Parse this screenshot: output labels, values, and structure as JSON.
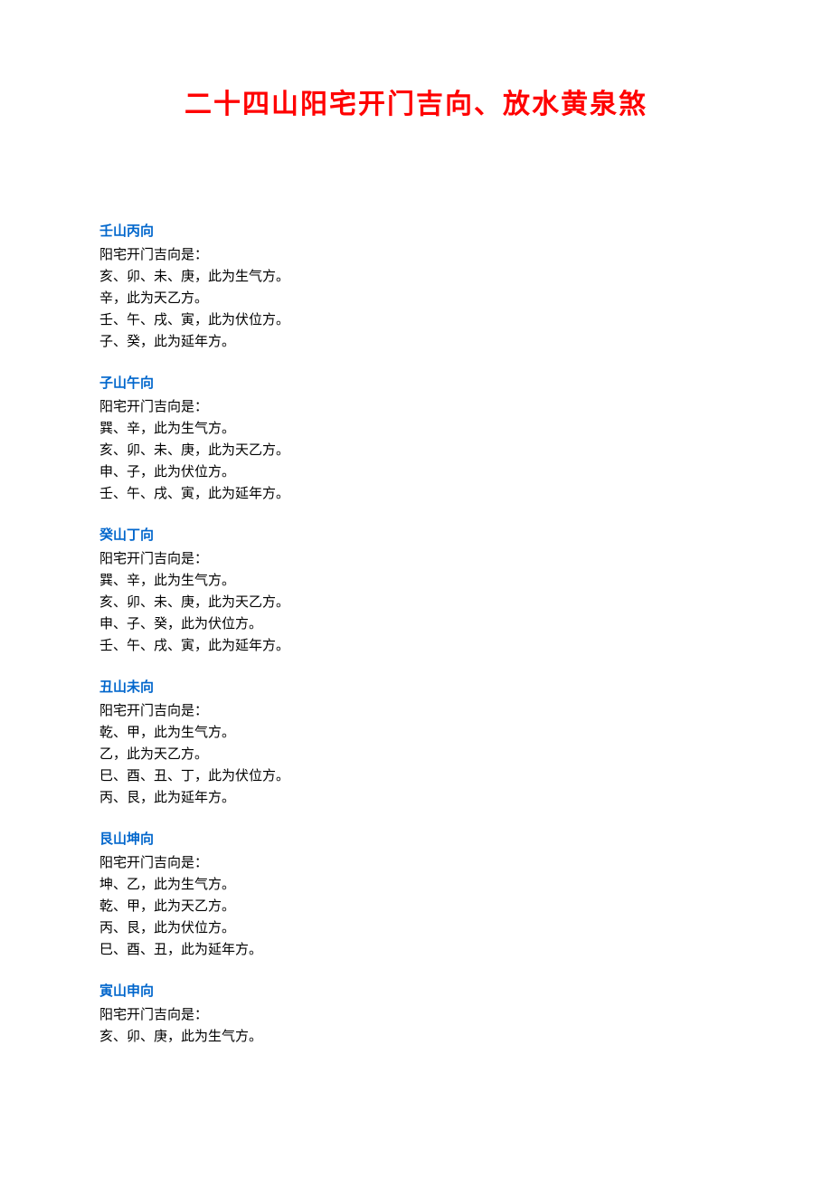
{
  "title": "二十四山阳宅开门吉向、放水黄泉煞",
  "sections": [
    {
      "heading": "壬山丙向",
      "lines": [
        "阳宅开门吉向是：",
        "亥、卯、未、庚，此为生气方。",
        "辛，此为天乙方。",
        "壬、午、戌、寅，此为伏位方。",
        "子、癸，此为延年方。"
      ]
    },
    {
      "heading": "子山午向",
      "lines": [
        "阳宅开门吉向是：",
        "巽、辛，此为生气方。",
        "亥、卯、未、庚，此为天乙方。",
        "申、子，此为伏位方。",
        "壬、午、戌、寅，此为延年方。"
      ]
    },
    {
      "heading": "癸山丁向",
      "lines": [
        "阳宅开门吉向是：",
        "巽、辛，此为生气方。",
        "亥、卯、未、庚，此为天乙方。",
        "申、子、癸，此为伏位方。",
        "壬、午、戌、寅，此为延年方。"
      ]
    },
    {
      "heading": "丑山未向",
      "lines": [
        "阳宅开门吉向是：",
        "乾、甲，此为生气方。",
        "乙，此为天乙方。",
        "巳、酉、丑、丁，此为伏位方。",
        "丙、艮，此为延年方。"
      ]
    },
    {
      "heading": "艮山坤向",
      "lines": [
        "阳宅开门吉向是：",
        "坤、乙，此为生气方。",
        "乾、甲，此为天乙方。",
        "丙、艮，此为伏位方。",
        "巳、酉、丑，此为延年方。"
      ]
    },
    {
      "heading": "寅山申向",
      "lines": [
        "阳宅开门吉向是：",
        "亥、卯、庚，此为生气方。"
      ]
    }
  ]
}
